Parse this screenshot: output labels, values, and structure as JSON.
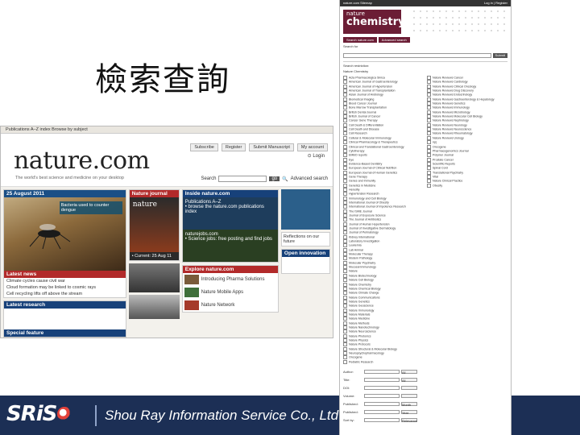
{
  "slide": {
    "title": "檢索查詢",
    "footer_logo": "SRiS",
    "footer_company": "Shou Ray Information Service Co., Ltd"
  },
  "nature_home": {
    "breadcrumb": "Publications A–Z index   Browse by subject",
    "logo": "nature.com",
    "tagline": "The world's best science and medicine on your desktop",
    "top_links": [
      "Subscribe",
      "Register",
      "Submit Manuscript",
      "My account"
    ],
    "login": "Login",
    "search_label": "Search",
    "search_button": "go",
    "advanced_search": "Advanced search",
    "hero_date": "25 August 2011",
    "hero_caption": "Bacteria used to counter dengue",
    "latest_news_header": "Latest news",
    "news_items": [
      "Climate cycles cause civil war",
      "Cloud formation may be linked to cosmic rays",
      "Cell recycling lifts off above the stream"
    ],
    "journal_header": "Nature journal",
    "journal_title": "nature",
    "journal_date": "• Current: 25 Aug 11",
    "inside_header": "Inside nature.com",
    "pubs_header": "Publications A–Z",
    "pubs_text": "• browse the nature.com publications index",
    "jobs_label": "naturejobs.com",
    "jobs_text": "• Science jobs: free posting and find jobs",
    "research_header": "Latest research",
    "explore_header": "Explore nature.com",
    "explore_items": [
      "Introducing Pharma Solutions",
      "Nature Mobile Apps",
      "Nature Network"
    ],
    "special_header": "Special feature",
    "reflections_label": "Reflections on our future",
    "open_innovation": "Open innovation"
  },
  "chemistry_search": {
    "top_left": "nature.com  Sitemap",
    "top_right": "Log in  |  Register",
    "logo_line1": "nature",
    "logo_line2": "chemistry",
    "tabs": [
      "Search nature.com",
      "Advanced search"
    ],
    "search_label": "Search for",
    "search_button": "Submit",
    "search_site": "Nature Chemistry",
    "section_header": "Search restriction:",
    "journal_list_left": [
      "Acta Pharmacologica Sinica",
      "American Journal of Gastroenterology",
      "American Journal of Hypertension",
      "American Journal of Transplantation",
      "Asian Journal of Andrology",
      "Biomedical Imaging",
      "Blood Cancer Journal",
      "Bone Marrow Transplantation",
      "British Dental Journal",
      "British Journal of Cancer",
      "Cancer Gene Therapy",
      "Cell Death & Differentiation",
      "Cell Death and Disease",
      "Cell Research",
      "Cellular & Molecular Immunology",
      "Clinical Pharmacology & Therapeutics",
      "Clinical and Translational Gastroenterology",
      "Cytotherapy",
      "EMBO reports",
      "Eye",
      "Evidence-Based Dentistry",
      "European Journal of Clinical Nutrition",
      "European Journal of Human Genetics",
      "Gene Therapy",
      "Genes and Immunity",
      "Genetics in Medicine",
      "Heredity",
      "Hypertension Research",
      "Immunology and Cell Biology",
      "International Journal of Obesity",
      "International Journal of Impotence Research",
      "The ISME Journal",
      "Journal of Exposure Science",
      "The Journal of Antibiotics",
      "Journal of Human Hypertension",
      "Journal of Investigative Dermatology",
      "Journal of Perinatology",
      "Kidney International",
      "Laboratory Investigation",
      "Leukemia",
      "Lab Animal",
      "Molecular Therapy",
      "Modern Pathology",
      "Molecular Psychiatry",
      "Mucosal Immunology",
      "Nature",
      "Nature Biotechnology",
      "Nature Cell Biology",
      "Nature Chemistry",
      "Nature Chemical Biology",
      "Nature Climate Change",
      "Nature Communications",
      "Nature Genetics",
      "Nature Geoscience",
      "Nature Immunology",
      "Nature Materials",
      "Nature Medicine",
      "Nature Methods",
      "Nature Nanotechnology",
      "Nature Neuroscience",
      "Nature Photonics",
      "Nature Physics",
      "Nature Protocols",
      "Nature Structural & Molecular Biology",
      "Neuropsychopharmacology",
      "Oncogene",
      "Pediatric Research"
    ],
    "journal_list_right": [
      "Nature Reviews Cancer",
      "Nature Reviews Cardiology",
      "Nature Reviews Clinical Oncology",
      "Nature Reviews Drug Discovery",
      "Nature Reviews Endocrinology",
      "Nature Reviews Gastroenterology & Hepatology",
      "Nature Reviews Genetics",
      "Nature Reviews Immunology",
      "Nature Reviews Microbiology",
      "Nature Reviews Molecular Cell Biology",
      "Nature Reviews Nephrology",
      "Nature Reviews Neurology",
      "Nature Reviews Neuroscience",
      "Nature Reviews Rheumatology",
      "Nature Reviews Urology",
      "npj",
      "Oncogene",
      "Pharmacogenomics Journal",
      "Polymer Journal",
      "Prostate Cancer",
      "Scientific Reports",
      "Spinal Cord",
      "Translational Psychiatry",
      "Vital",
      "Nature Clinical Practice",
      "Obesity"
    ],
    "fields": [
      {
        "label": "Author:",
        "select": "All"
      },
      {
        "label": "Title:",
        "select": "All"
      },
      {
        "label": "DOI:",
        "select": ""
      },
      {
        "label": "Volume:",
        "select": ""
      },
      {
        "label": "Published:",
        "select": "Month"
      },
      {
        "label": "Published:",
        "select": "Year"
      },
      {
        "label": "Sort by:",
        "select": "Relevance"
      }
    ]
  }
}
